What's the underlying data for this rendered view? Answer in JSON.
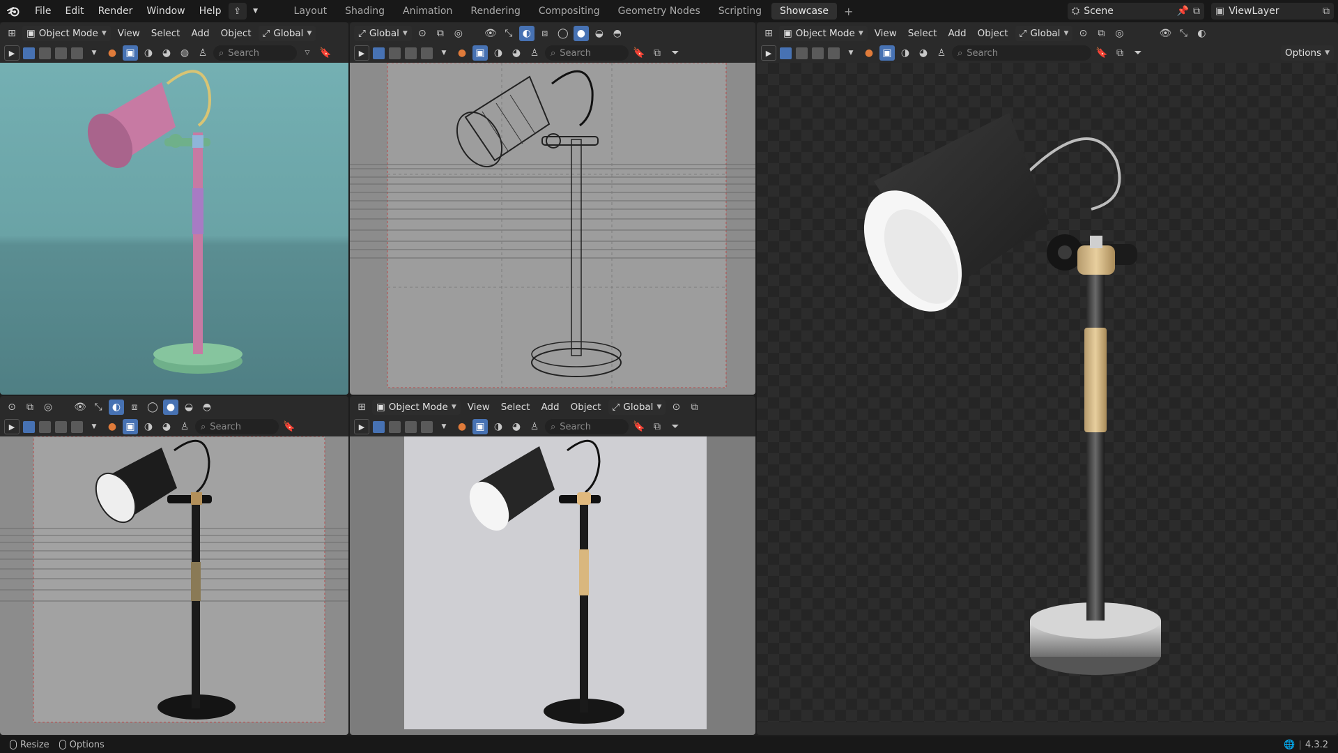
{
  "menu": [
    "File",
    "Edit",
    "Render",
    "Window",
    "Help"
  ],
  "workspaces": [
    "Layout",
    "Shading",
    "Animation",
    "Rendering",
    "Compositing",
    "Geometry Nodes",
    "Scripting",
    "Showcase"
  ],
  "active_workspace": "Showcase",
  "scene": {
    "name": "Scene",
    "view_layer": "ViewLayer"
  },
  "header": {
    "mode": "Object Mode",
    "view": "View",
    "select": "Select",
    "add": "Add",
    "object": "Object",
    "orientation": "Global",
    "search_placeholder": "Search",
    "options": "Options"
  },
  "status": {
    "resize": "Resize",
    "options": "Options",
    "version": "4.3.2"
  },
  "colors": {
    "accent": "#4772b3",
    "lamp_pink": "#c77aa3",
    "lamp_base_green": "#6fb08a",
    "viewport_teal": "#6fa5a8"
  }
}
